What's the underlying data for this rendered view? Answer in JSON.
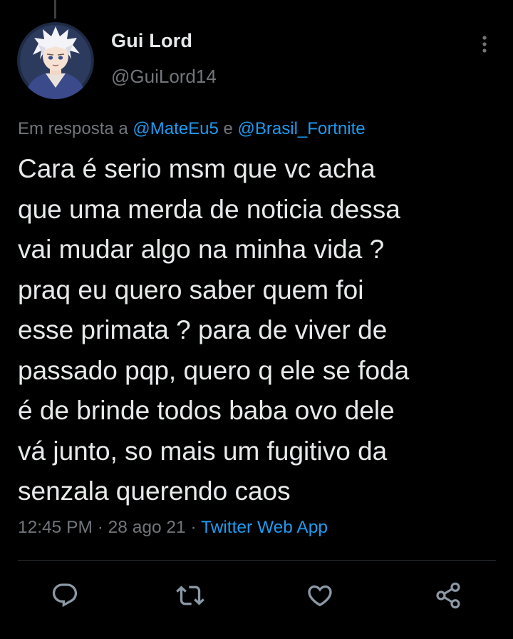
{
  "author": {
    "display_name": "Gui Lord",
    "handle": "@GuiLord14",
    "avatar_icon": "anime-character-avatar"
  },
  "reply_context": {
    "prefix": "Em resposta a",
    "mention_1": "@MateEu5",
    "conjunction": "e",
    "mention_2": "@Brasil_Fortnite"
  },
  "tweet": {
    "lines": [
      "Cara é serio msm que vc acha",
      "que uma merda de noticia dessa",
      "vai mudar algo na minha vida ?",
      "praq eu quero saber quem foi",
      "esse primata ? para de viver de",
      "passado pqp, quero q ele se foda",
      "é de brinde todos baba ovo dele",
      "vá junto, so mais um fugitivo da",
      "senzala querendo caos"
    ]
  },
  "meta": {
    "time": "12:45 PM",
    "separator": "·",
    "date": "28 ago 21",
    "source": "Twitter Web App"
  },
  "actions": {
    "reply_icon": "reply-icon",
    "retweet_icon": "retweet-icon",
    "like_icon": "heart-icon",
    "share_icon": "share-icon"
  },
  "colors": {
    "background": "#000000",
    "text_primary": "#e7e9ea",
    "text_secondary": "#71767b",
    "link": "#1d9bf0"
  }
}
